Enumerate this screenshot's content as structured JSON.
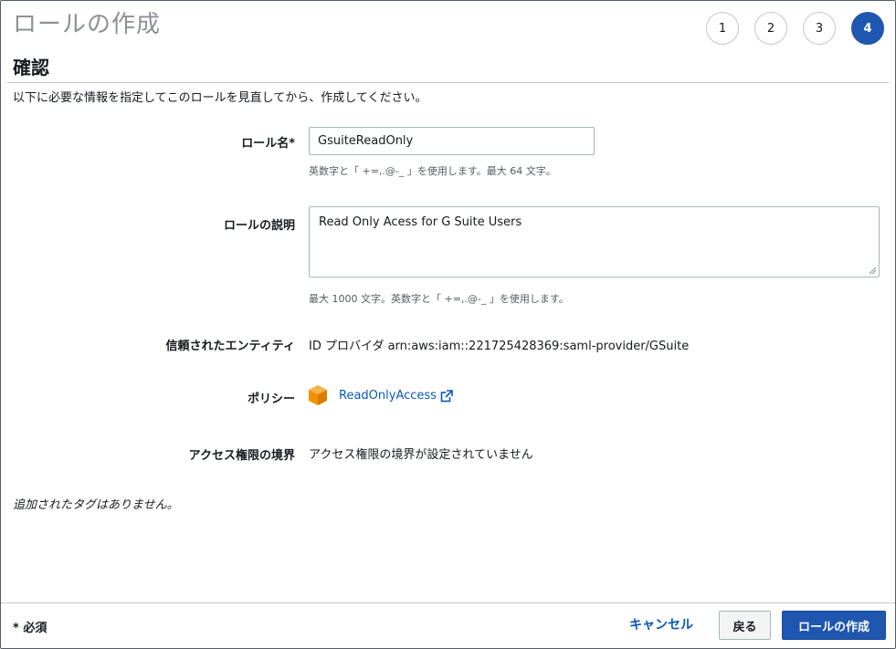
{
  "header": {
    "title": "ロールの作成",
    "steps": [
      "1",
      "2",
      "3",
      "4"
    ],
    "active_step": "4"
  },
  "section": {
    "title": "確認",
    "intro": "以下に必要な情報を指定してこのロールを見直してから、作成してください。"
  },
  "form": {
    "role_name": {
      "label": "ロール名*",
      "value": "GsuiteReadOnly",
      "hint": "英数字と「 +=,.@-_ 」を使用します。最大 64 文字。"
    },
    "description": {
      "label": "ロールの説明",
      "value": "Read Only Acess for G Suite Users",
      "hint": "最大 1000 文字。英数字と「 +=,.@-_ 」を使用します。"
    },
    "trusted_entity": {
      "label": "信頼されたエンティティ",
      "value": "ID プロバイダ arn:aws:iam::221725428369:saml-provider/GSuite"
    },
    "policy": {
      "label": "ポリシー",
      "link": "ReadOnlyAccess",
      "icon": "aws-cube-icon",
      "icon_color": "#f29100"
    },
    "boundary": {
      "label": "アクセス権限の境界",
      "value": "アクセス権限の境界が設定されていません"
    }
  },
  "tags": {
    "empty_text": "追加されたタグはありません。"
  },
  "footer": {
    "required_note": "* 必須",
    "cancel_label": "キャンセル",
    "back_label": "戻る",
    "create_label": "ロールの作成"
  },
  "colors": {
    "primary": "#1f56b0",
    "link": "#0a57b8"
  }
}
